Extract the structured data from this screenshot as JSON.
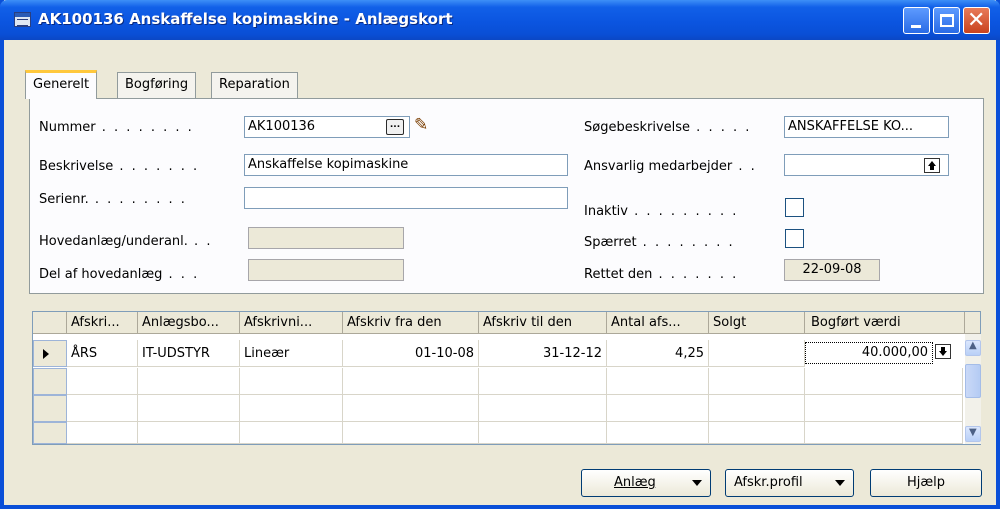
{
  "window": {
    "title": "AK100136 Anskaffelse kopimaskine - Anlægskort"
  },
  "tabs": [
    {
      "label": "Generelt",
      "active": true
    },
    {
      "label": "Bogføring",
      "active": false
    },
    {
      "label": "Reparation",
      "active": false
    }
  ],
  "general": {
    "nummer_label": "Nummer",
    "nummer_value": "AK100136",
    "beskrivelse_label": "Beskrivelse",
    "beskrivelse_value": "Anskaffelse kopimaskine",
    "serienr_label": "Serienr.",
    "serienr_value": "",
    "hovedanlaeg_label": "Hovedanlæg/underanl.",
    "hovedanlaeg_value": "",
    "delaf_label": "Del af hovedanlæg",
    "delaf_value": "",
    "soegebeskrivelse_label": "Søgebeskrivelse",
    "soegebeskrivelse_value": "ANSKAFFELSE KO...",
    "ansvarlig_label": "Ansvarlig medarbejder",
    "ansvarlig_value": "",
    "inaktiv_label": "Inaktiv",
    "inaktiv_checked": false,
    "spaerret_label": "Spærret",
    "spaerret_checked": false,
    "rettet_label": "Rettet den",
    "rettet_value": "22-09-08",
    "assist_glyph": "..."
  },
  "grid": {
    "columns": [
      "Afskri...",
      "Anlægsbo...",
      "Afskrivni...",
      "Afskriv fra den",
      "Afskriv til den",
      "Antal afs...",
      "Solgt",
      "Bogført værdi"
    ],
    "rows": [
      {
        "afskr": "ÅRS",
        "anlaeg": "IT-UDSTYR",
        "metode": "Lineær",
        "fra": "01-10-08",
        "til": "31-12-12",
        "antal": "4,25",
        "solgt": "",
        "vaerdi": "40.000,00"
      },
      {
        "afskr": "",
        "anlaeg": "",
        "metode": "",
        "fra": "",
        "til": "",
        "antal": "",
        "solgt": "",
        "vaerdi": ""
      },
      {
        "afskr": "",
        "anlaeg": "",
        "metode": "",
        "fra": "",
        "til": "",
        "antal": "",
        "solgt": "",
        "vaerdi": ""
      },
      {
        "afskr": "",
        "anlaeg": "",
        "metode": "",
        "fra": "",
        "til": "",
        "antal": "",
        "solgt": "",
        "vaerdi": ""
      }
    ]
  },
  "buttons": {
    "anlaeg": "Anlæg",
    "afskr_profil": "Afskr.profil",
    "hjaelp": "Hjælp"
  },
  "colors": {
    "title_bar": "#0b55e0",
    "window_bg": "#ece9d8",
    "tab_highlight": "#ffc83c"
  }
}
